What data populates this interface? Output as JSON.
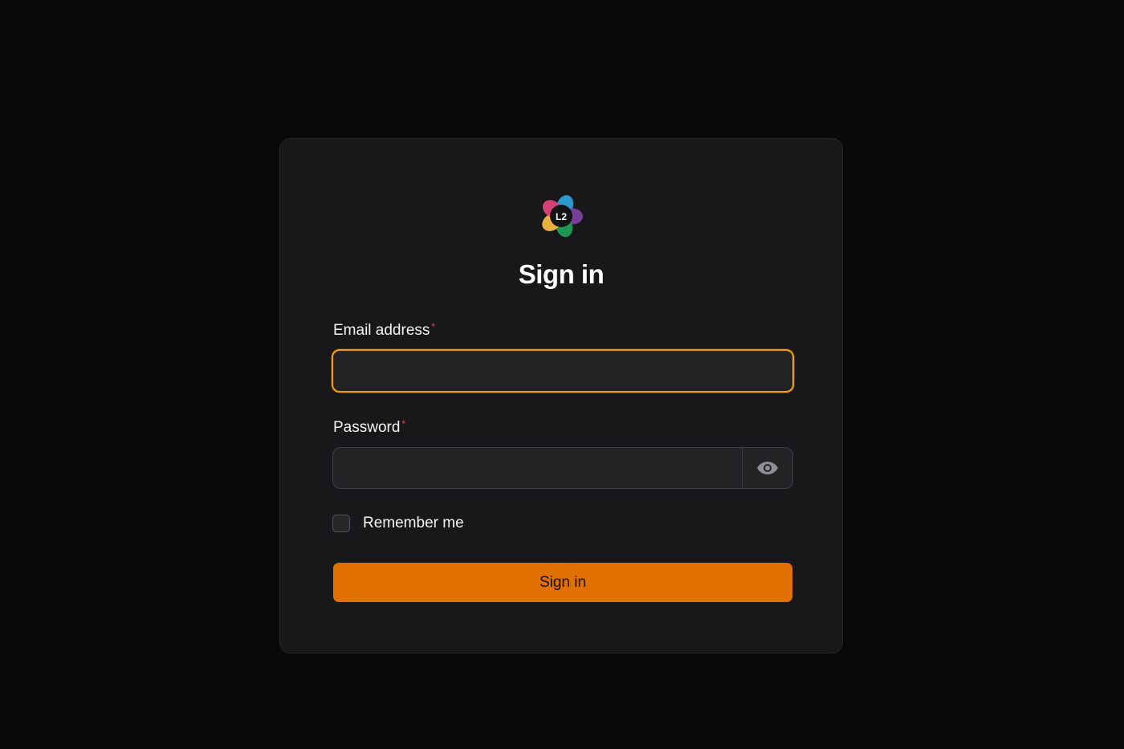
{
  "form": {
    "logo_text": "L2",
    "title": "Sign in",
    "email": {
      "label": "Email address",
      "required_mark": "*",
      "value": "",
      "placeholder": ""
    },
    "password": {
      "label": "Password",
      "required_mark": "*",
      "value": "",
      "placeholder": ""
    },
    "remember_label": "Remember me",
    "remember_checked": false,
    "submit_label": "Sign in"
  },
  "colors": {
    "background": "#09090b",
    "card": "#18181b",
    "accent": "#e07000",
    "focus_ring": "#f59e0b",
    "required": "#ef4444"
  },
  "icons": {
    "logo": "l2-flower-logo",
    "password_toggle": "eye-icon"
  }
}
